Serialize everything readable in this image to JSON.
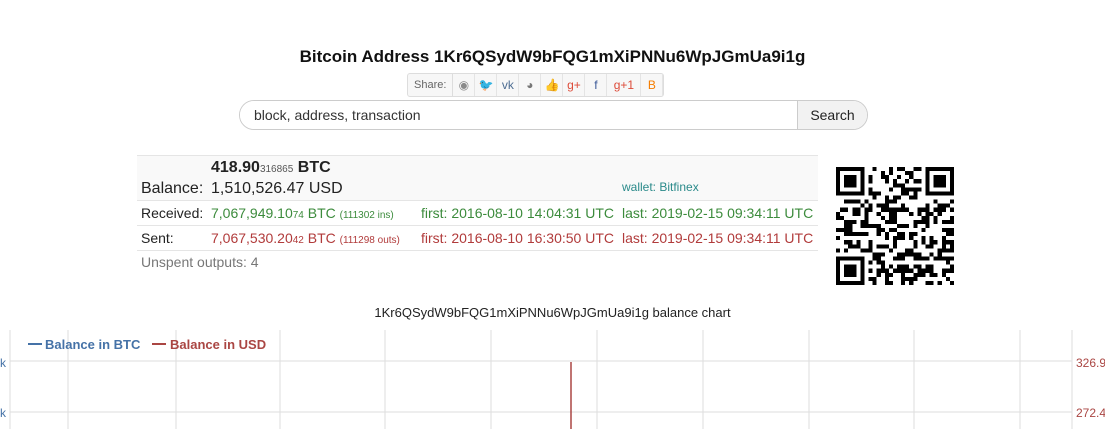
{
  "header": {
    "title": "Bitcoin Address 1Kr6QSydW9bFQG1mXiPNNu6WpJGmUa9i1g"
  },
  "share": {
    "label": "Share:",
    "buttons": [
      {
        "name": "reddit",
        "glyph": "◉",
        "color": "#8a8a8a"
      },
      {
        "name": "twitter",
        "glyph": "🐦",
        "color": "#4aa0d9"
      },
      {
        "name": "vk",
        "glyph": "vk",
        "color": "#4c6c91"
      },
      {
        "name": "weibo",
        "glyph": "◕",
        "color": "#777"
      },
      {
        "name": "like",
        "glyph": "👍",
        "color": "#4c78c8"
      },
      {
        "name": "google-plus",
        "glyph": "g+",
        "color": "#dd4b39"
      },
      {
        "name": "facebook",
        "glyph": "f",
        "color": "#3b5998"
      },
      {
        "name": "google-plus-one",
        "glyph": "g+1",
        "color": "#dd4b39"
      },
      {
        "name": "blogger",
        "glyph": "B",
        "color": "#f57d00"
      }
    ]
  },
  "search": {
    "placeholder": "block, address, transaction",
    "button": "Search"
  },
  "balance": {
    "btc_main": "418.90",
    "btc_small": "316865",
    "btc_unit": "BTC",
    "label": "Balance:",
    "usd": "1,510,526.47 USD",
    "wallet": "wallet: Bitfinex"
  },
  "received": {
    "label": "Received:",
    "amount_main": "7,067,949.10",
    "amount_small": "74",
    "unit": "BTC",
    "ins": "(111302 ins)",
    "first": "first: 2016-08-10 14:04:31 UTC",
    "last": "last: 2019-02-15 09:34:11 UTC"
  },
  "sent": {
    "label": "Sent:",
    "amount_main": "7,067,530.20",
    "amount_small": "42",
    "unit": "BTC",
    "outs": "(111298 outs)",
    "first": "first: 2016-08-10 16:30:50 UTC",
    "last": "last: 2019-02-15 09:34:11 UTC"
  },
  "unspent": "Unspent outputs: 4",
  "chart_data": {
    "type": "line",
    "title": "1Kr6QSydW9bFQG1mXiPNNu6WpJGmUa9i1g balance chart",
    "series": [
      {
        "name": "Balance in BTC",
        "color": "#4572a7"
      },
      {
        "name": "Balance in USD",
        "color": "#aa4643"
      }
    ],
    "left_axis_ticks": [
      "k",
      "k"
    ],
    "right_axis_ticks": [
      "326.9",
      "272.4"
    ],
    "legend_position": "top-left",
    "grid": true
  }
}
